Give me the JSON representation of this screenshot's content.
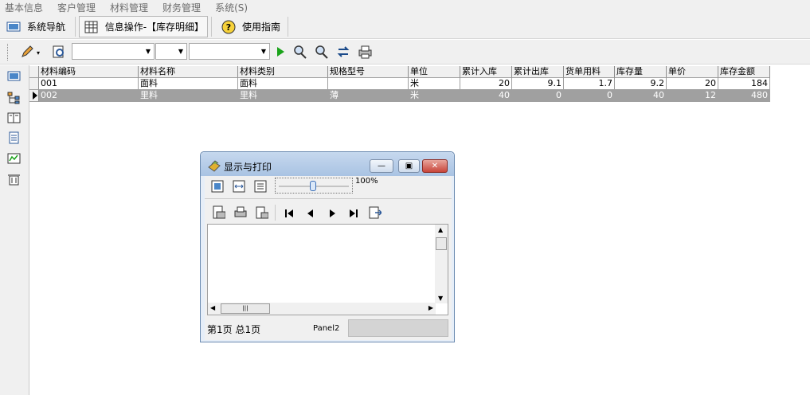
{
  "menu": [
    "基本信息",
    "客户管理",
    "材料管理",
    "财务管理",
    "系统(S)"
  ],
  "nav": {
    "system_nav": "系统导航",
    "info_tab": "信息操作-【库存明细】",
    "guide": "使用指南"
  },
  "grid": {
    "headers": [
      "材料编码",
      "材料名称",
      "材料类别",
      "规格型号",
      "单位",
      "累计入库",
      "累计出库",
      "货单用料",
      "库存量",
      "单价",
      "库存金额"
    ],
    "rows": [
      [
        "001",
        "面料",
        "面料",
        "",
        "米",
        "20",
        "9.1",
        "1.7",
        "9.2",
        "20",
        "184"
      ],
      [
        "002",
        "里料",
        "里料",
        "薄",
        "米",
        "40",
        "0",
        "0",
        "40",
        "12",
        "480"
      ]
    ],
    "selected_row": 1
  },
  "dialog": {
    "title": "显示与打印",
    "zoom": "100%",
    "page_info": "第1页 总1页",
    "panel": "Panel2"
  },
  "colors": {
    "accent": "#3c6fb7",
    "selected_row": "#a0a0a0",
    "close_button": "#c9453a"
  }
}
